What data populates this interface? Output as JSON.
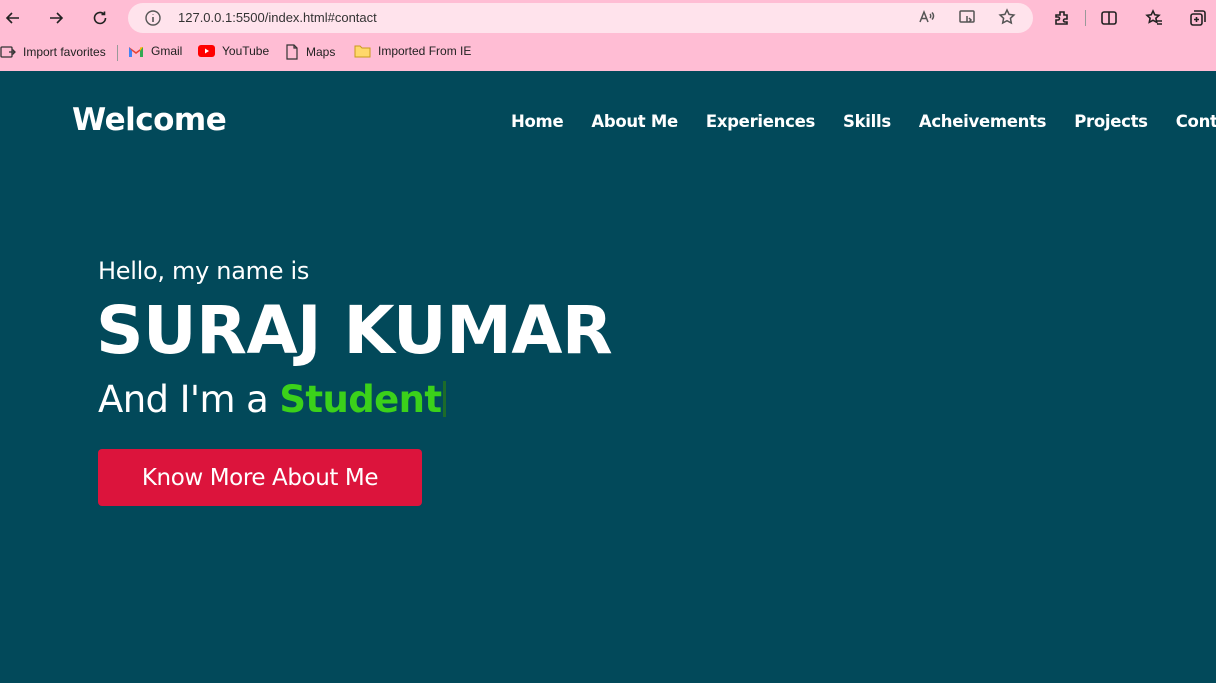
{
  "browser": {
    "url": "127.0.0.1:5500/index.html#contact",
    "bookmarks": [
      {
        "label": "Import favorites",
        "icon": "import-icon"
      },
      {
        "label": "Gmail",
        "icon": "gmail-icon"
      },
      {
        "label": "YouTube",
        "icon": "youtube-icon"
      },
      {
        "label": "Maps",
        "icon": "page-icon"
      },
      {
        "label": "Imported From IE",
        "icon": "folder-icon"
      }
    ]
  },
  "nav": {
    "logo": "Welcome",
    "items": [
      "Home",
      "About Me",
      "Experiences",
      "Skills",
      "Acheivements",
      "Projects",
      "Contact"
    ]
  },
  "hero": {
    "greeting": "Hello, my name is",
    "name": "SURAJ KUMAR",
    "role_prefix": "And I'm a ",
    "role_typed": "Student",
    "cta_label": "Know More About Me"
  },
  "colors": {
    "background": "#02495a",
    "chrome": "#ffbdd4",
    "accent_green": "#3bd11a",
    "cta": "#dc143c"
  }
}
